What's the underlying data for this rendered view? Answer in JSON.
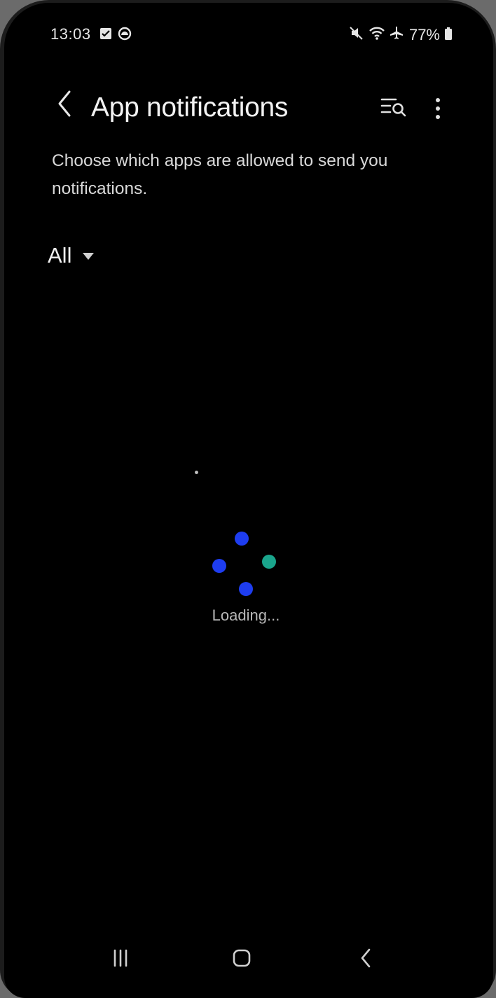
{
  "status_bar": {
    "time": "13:03",
    "battery": "77%",
    "left_icons": [
      "checkbox-icon",
      "record-icon"
    ],
    "right_icons": [
      "mute-icon",
      "wifi-icon",
      "airplane-icon",
      "battery-icon"
    ]
  },
  "header": {
    "title": "App notifications",
    "back_icon": "chevron-left-icon",
    "search_icon": "search-list-icon",
    "more_icon": "more-vert-icon"
  },
  "description": "Choose which apps are allowed to send you notifications.",
  "filter": {
    "selected": "All",
    "icon": "caret-down-icon"
  },
  "loading": {
    "text": "Loading...",
    "colors": {
      "blue": "#1e3df0",
      "teal": "#1aa58c"
    }
  },
  "nav_bar": {
    "recents_icon": "recents-icon",
    "home_icon": "home-icon",
    "back_icon": "back-icon"
  },
  "colors": {
    "background": "#000000",
    "text": "#f2f2f2",
    "secondary_text": "#d9d9d9"
  }
}
